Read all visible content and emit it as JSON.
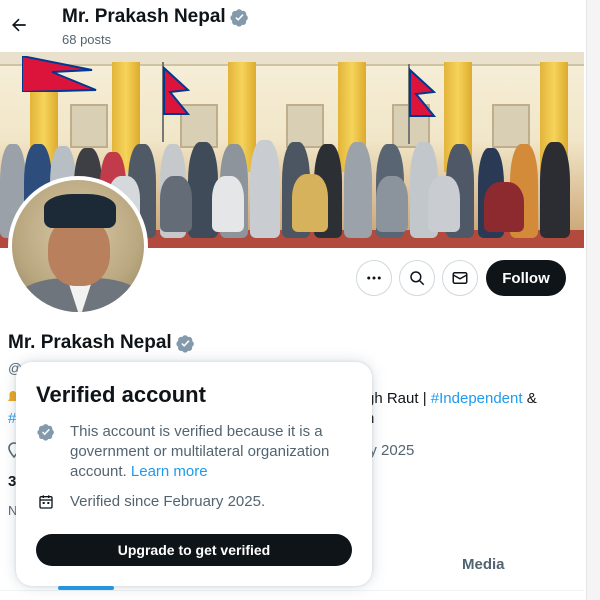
{
  "header": {
    "name": "Mr. Prakash Nepal",
    "posts": "68 posts",
    "back_icon": "arrow-left-icon",
    "badge_icon": "verified-badge-icon"
  },
  "actions": {
    "more_icon": "more-horizontal-icon",
    "search_icon": "search-icon",
    "message_icon": "envelope-icon",
    "follow_label": "Follow"
  },
  "profile": {
    "name": "Mr. Prakash Nepal",
    "handle_visible": "@",
    "bio_partial_1": "gh Raut | ",
    "bio_link_1": "#Independent",
    "bio_partial_1_end": " &",
    "bio_partial_2_left": "#",
    "bio_partial_2_right": "n",
    "joined_partial": "ary 2025",
    "count_partial": "3",
    "n_partial": "N"
  },
  "tabs": {
    "media": "Media"
  },
  "popover": {
    "title": "Verified account",
    "reason_text": "This account is verified because it is a government or multilateral organization account.",
    "learn_more": "Learn more",
    "since_text": "Verified since February 2025.",
    "upgrade_label": "Upgrade to get verified",
    "badge_icon": "verified-badge-gray-icon",
    "calendar_icon": "calendar-icon"
  },
  "colors": {
    "accent": "#1d9bf0",
    "text": "#0f1419",
    "muted": "#536471",
    "gray_badge": "#829aab"
  }
}
